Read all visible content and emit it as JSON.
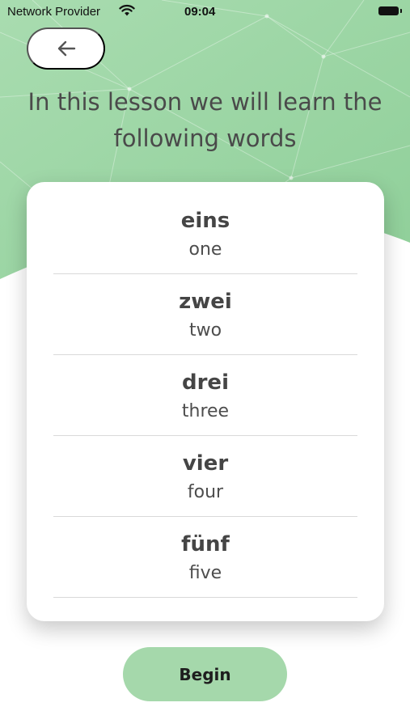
{
  "status_bar": {
    "carrier": "Network Provider",
    "time": "09:04",
    "wifi_icon": "wifi-icon",
    "battery_icon": "battery-icon"
  },
  "header": {
    "back_icon": "arrow-left-icon",
    "title": "In this lesson we will learn the following words"
  },
  "words": [
    {
      "german": "eins",
      "english": "one"
    },
    {
      "german": "zwei",
      "english": "two"
    },
    {
      "german": "drei",
      "english": "three"
    },
    {
      "german": "vier",
      "english": "four"
    },
    {
      "german": "fünf",
      "english": "five"
    }
  ],
  "actions": {
    "begin_label": "Begin"
  },
  "colors": {
    "accent_green": "#a5d8ab",
    "text": "#424242",
    "card_bg": "#ffffff"
  }
}
